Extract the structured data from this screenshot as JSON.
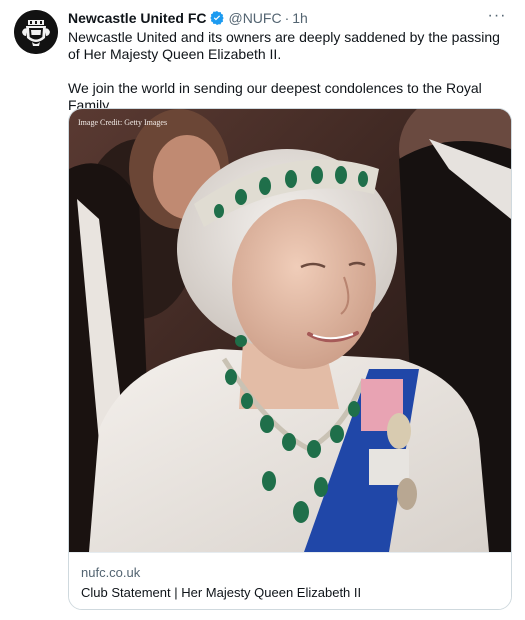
{
  "tweet": {
    "display_name": "Newcastle United FC",
    "handle": "@NUFC",
    "separator": "·",
    "time": "1h",
    "more_label": "···",
    "text_line_1": "Newcastle United and its owners are deeply saddened by the passing of Her Majesty Queen Elizabeth II.",
    "text_line_2": "We join the world in sending our deepest condolences to the Royal Family.",
    "verified_icon": "verified-badge-icon",
    "avatar_icon": "club-crest-icon"
  },
  "card": {
    "image_credit": "Image Credit: Getty Images",
    "domain": "nufc.co.uk",
    "title": "Club Statement | Her Majesty Queen Elizabeth II"
  },
  "colors": {
    "verified": "#1d9bf0",
    "text": "#0f1419",
    "secondary": "#536471",
    "border": "#cfd9de"
  }
}
